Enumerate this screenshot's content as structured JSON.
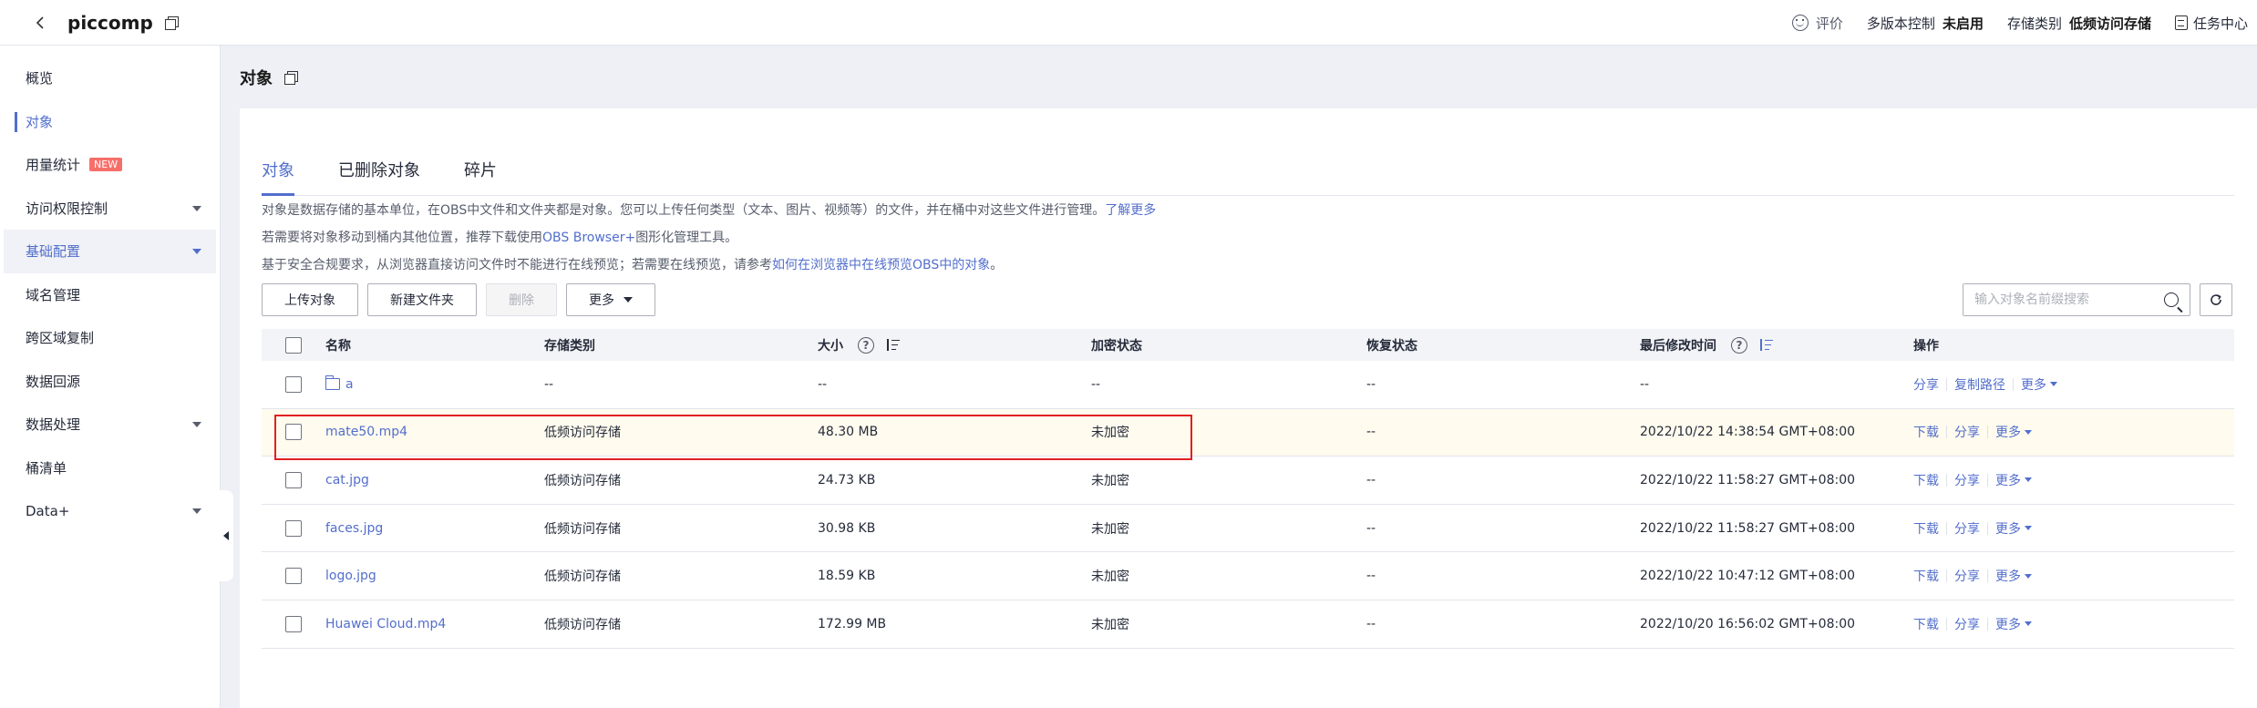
{
  "header": {
    "bucket_name": "piccomp",
    "feedback": "评价",
    "versioning_label": "多版本控制",
    "versioning_value": "未启用",
    "storage_class_label": "存储类别",
    "storage_class_value": "低频访问存储",
    "task_center": "任务中心"
  },
  "sidebar": {
    "items": [
      {
        "label": "概览"
      },
      {
        "label": "对象"
      },
      {
        "label": "用量统计",
        "badge": "NEW"
      },
      {
        "label": "访问权限控制"
      },
      {
        "label": "基础配置"
      },
      {
        "label": "域名管理"
      },
      {
        "label": "跨区域复制"
      },
      {
        "label": "数据回源"
      },
      {
        "label": "数据处理"
      },
      {
        "label": "桶清单"
      },
      {
        "label": "Data+"
      }
    ]
  },
  "main": {
    "title": "对象",
    "tabs": [
      "对象",
      "已删除对象",
      "碎片"
    ],
    "desc1_text": "对象是数据存储的基本单位，在OBS中文件和文件夹都是对象。您可以上传任何类型（文本、图片、视频等）的文件，并在桶中对这些文件进行管理。",
    "desc1_link": "了解更多",
    "desc2_prefix": "若需要将对象移动到桶内其他位置，推荐下载使用",
    "desc2_link": "OBS Browser+",
    "desc2_suffix": "图形化管理工具。",
    "desc3_prefix": "基于安全合规要求，从浏览器直接访问文件时不能进行在线预览；若需要在线预览，请参考",
    "desc3_link": "如何在浏览器中在线预览OBS中的对象",
    "desc3_suffix": "。",
    "buttons": {
      "upload": "上传对象",
      "new_folder": "新建文件夹",
      "delete": "删除",
      "more": "更多"
    },
    "search_placeholder": "输入对象名前缀搜索"
  },
  "table": {
    "headers": {
      "name": "名称",
      "storage_class": "存储类别",
      "size": "大小",
      "encryption": "加密状态",
      "restore": "恢复状态",
      "modified": "最后修改时间",
      "ops": "操作"
    },
    "rows": [
      {
        "name": "a",
        "storage_class": "--",
        "size": "--",
        "encryption": "--",
        "restore": "--",
        "modified": "--",
        "op1": "分享",
        "op2": "复制路径",
        "op3": "更多"
      },
      {
        "name": "mate50.mp4",
        "storage_class": "低频访问存储",
        "size": "48.30 MB",
        "encryption": "未加密",
        "restore": "--",
        "modified": "2022/10/22 14:38:54 GMT+08:00",
        "op1": "下载",
        "op2": "分享",
        "op3": "更多"
      },
      {
        "name": "cat.jpg",
        "storage_class": "低频访问存储",
        "size": "24.73 KB",
        "encryption": "未加密",
        "restore": "--",
        "modified": "2022/10/22 11:58:27 GMT+08:00",
        "op1": "下载",
        "op2": "分享",
        "op3": "更多"
      },
      {
        "name": "faces.jpg",
        "storage_class": "低频访问存储",
        "size": "30.98 KB",
        "encryption": "未加密",
        "restore": "--",
        "modified": "2022/10/22 11:58:27 GMT+08:00",
        "op1": "下载",
        "op2": "分享",
        "op3": "更多"
      },
      {
        "name": "logo.jpg",
        "storage_class": "低频访问存储",
        "size": "18.59 KB",
        "encryption": "未加密",
        "restore": "--",
        "modified": "2022/10/22 10:47:12 GMT+08:00",
        "op1": "下载",
        "op2": "分享",
        "op3": "更多"
      },
      {
        "name": "Huawei Cloud.mp4",
        "storage_class": "低频访问存储",
        "size": "172.99 MB",
        "encryption": "未加密",
        "restore": "--",
        "modified": "2022/10/20 16:56:02 GMT+08:00",
        "op1": "下载",
        "op2": "分享",
        "op3": "更多"
      }
    ]
  },
  "colors": {
    "accent": "#526ecc",
    "highlight_border": "#e02020",
    "highlight_row": "#fffbee"
  }
}
